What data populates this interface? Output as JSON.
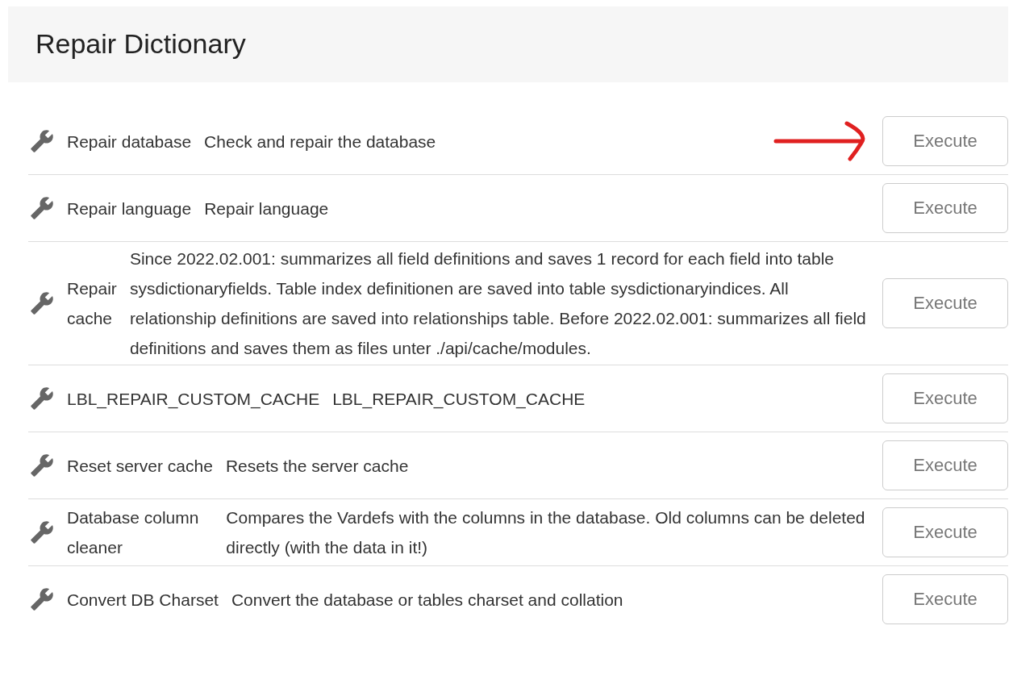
{
  "header": {
    "title": "Repair Dictionary"
  },
  "actions": [
    {
      "name": "Repair database",
      "description": "Check and repair the database",
      "button": "Execute",
      "annotated": true
    },
    {
      "name": "Repair language",
      "description": "Repair language",
      "button": "Execute",
      "annotated": false
    },
    {
      "name": "Repair cache",
      "description": "Since 2022.02.001: summarizes all field definitions and saves 1 record for each field into table sysdictionaryfields. Table index definitionen are saved into table sysdictionaryindices. All relationship definitions are saved into relationships table. Before 2022.02.001: summarizes all field definitions and saves them as files unter ./api/cache/modules.",
      "button": "Execute",
      "annotated": false
    },
    {
      "name": "LBL_REPAIR_CUSTOM_CACHE",
      "description": "LBL_REPAIR_CUSTOM_CACHE",
      "button": "Execute",
      "annotated": false
    },
    {
      "name": "Reset server cache",
      "description": "Resets the server cache",
      "button": "Execute",
      "annotated": false
    },
    {
      "name": "Database column cleaner",
      "description": "Compares the Vardefs with the columns in the database. Old columns can be deleted directly (with the data in it!)",
      "button": "Execute",
      "annotated": false
    },
    {
      "name": "Convert DB Charset",
      "description": "Convert the database or tables charset and collation",
      "button": "Execute",
      "annotated": false
    }
  ]
}
